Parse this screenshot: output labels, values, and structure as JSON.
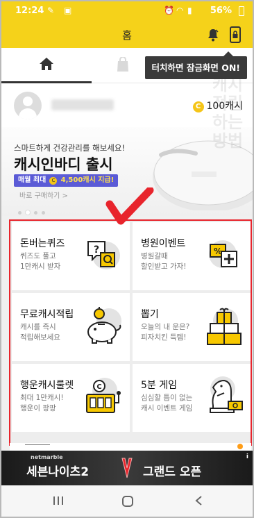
{
  "status_bar": {
    "time": "12:24",
    "battery": "56%"
  },
  "app_bar": {
    "title": "홈"
  },
  "tooltip": {
    "text": "터치하면 잠금화면 ON!"
  },
  "profile": {
    "cash": "100캐시",
    "coin_symbol": "C"
  },
  "banner": {
    "subtitle": "스마트하게 건강관리를 해보세요!",
    "title": "캐시인바디 출시",
    "pill_tag": "매월 최대",
    "pill_amount": "4,500캐시 지급!",
    "buy_link": "바로 구매하기 >",
    "slide_count": 4,
    "active_slide": 2
  },
  "cards": [
    {
      "title": "돈버는퀴즈",
      "desc": "퀴즈도 풀고\n1만캐시 받자",
      "icon": "quiz-icon"
    },
    {
      "title": "병원이벤트",
      "desc": "병원갈때\n할인받고 가자!",
      "icon": "hospital-coupon-icon"
    },
    {
      "title": "무료캐시적립",
      "desc": "캐시를 즉시\n적립해보세요",
      "icon": "piggy-bank-icon"
    },
    {
      "title": "뽑기",
      "desc": "오늘의 내 운은?\n피자치킨 득템!",
      "icon": "gift-boxes-icon"
    },
    {
      "title": "행운캐시룰렛",
      "desc": "최대 1만캐시!\n행운이 팡팡",
      "icon": "slot-machine-icon"
    },
    {
      "title": "5분 게임",
      "desc": "심심할 틈이 없는\n캐시 이벤트 게임",
      "icon": "chess-knight-icon"
    }
  ],
  "ad": {
    "brand": "netmarble",
    "game": "세븐나이츠2",
    "promo": "그랜드 오픈",
    "info": "i"
  },
  "watermark": "무료캐시적립하는방법",
  "colors": {
    "brand_yellow": "#f5d21a",
    "highlight_red": "#e8242c",
    "coin_gold": "#f5c518",
    "pill_purple": "#5b5bd6"
  }
}
